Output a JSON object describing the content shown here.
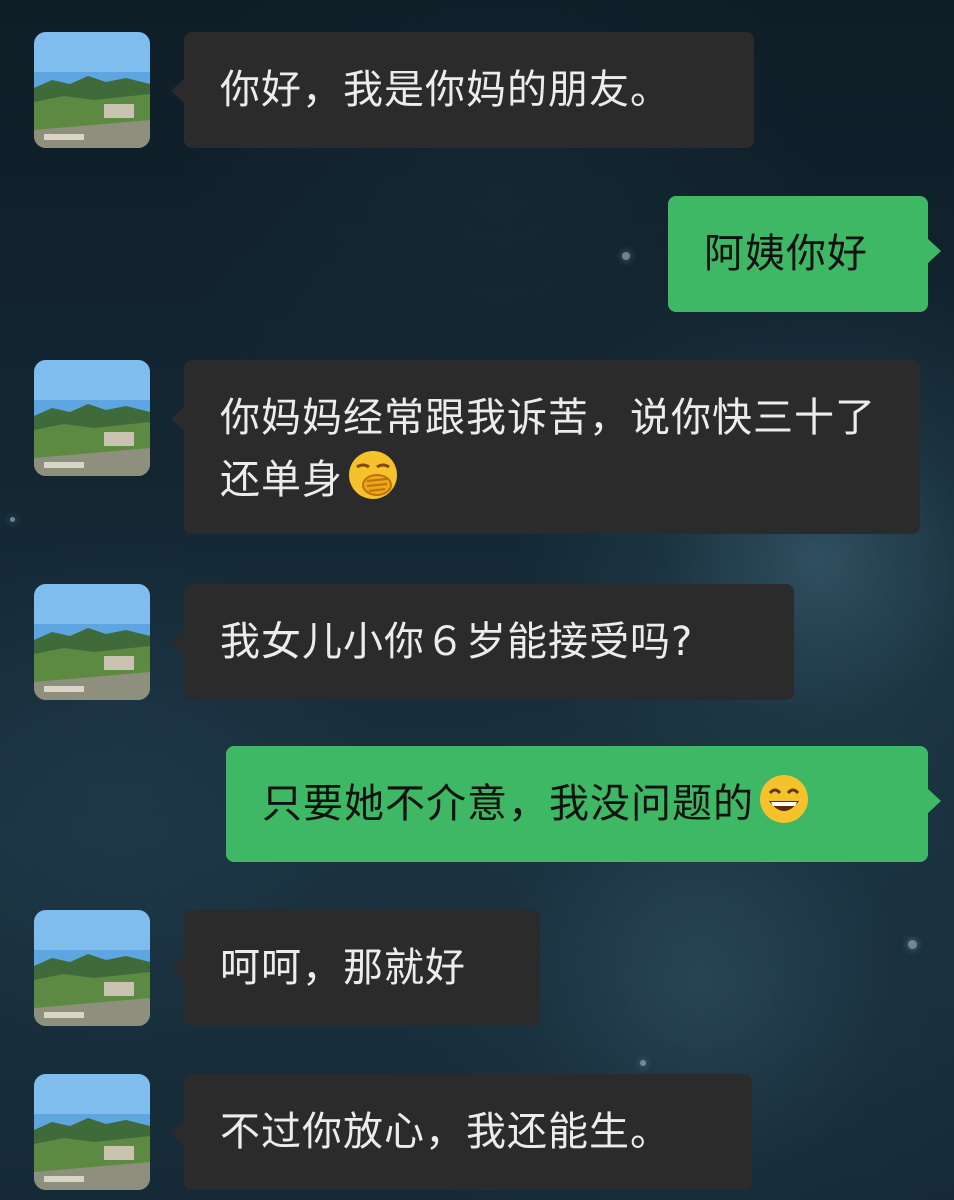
{
  "messages": [
    {
      "side": "in",
      "text": "你好，我是你妈的朋友。"
    },
    {
      "side": "out",
      "text": "阿姨你好"
    },
    {
      "side": "in",
      "text": "你妈妈经常跟我诉苦，说你快三十了还单身",
      "emoji": "face-with-hand-over-mouth-emoji"
    },
    {
      "side": "in",
      "text": "我女儿小你６岁能接受吗?"
    },
    {
      "side": "out",
      "text": "只要她不介意，我没问题的",
      "emoji": "grinning-face-emoji"
    },
    {
      "side": "in",
      "text": "呵呵，那就好"
    },
    {
      "side": "in",
      "text": "不过你放心，我还能生。"
    }
  ],
  "colors": {
    "incoming_bubble": "#2b2b2c",
    "outgoing_bubble": "#3eb864",
    "incoming_text": "#ececec",
    "outgoing_text": "#111111"
  }
}
